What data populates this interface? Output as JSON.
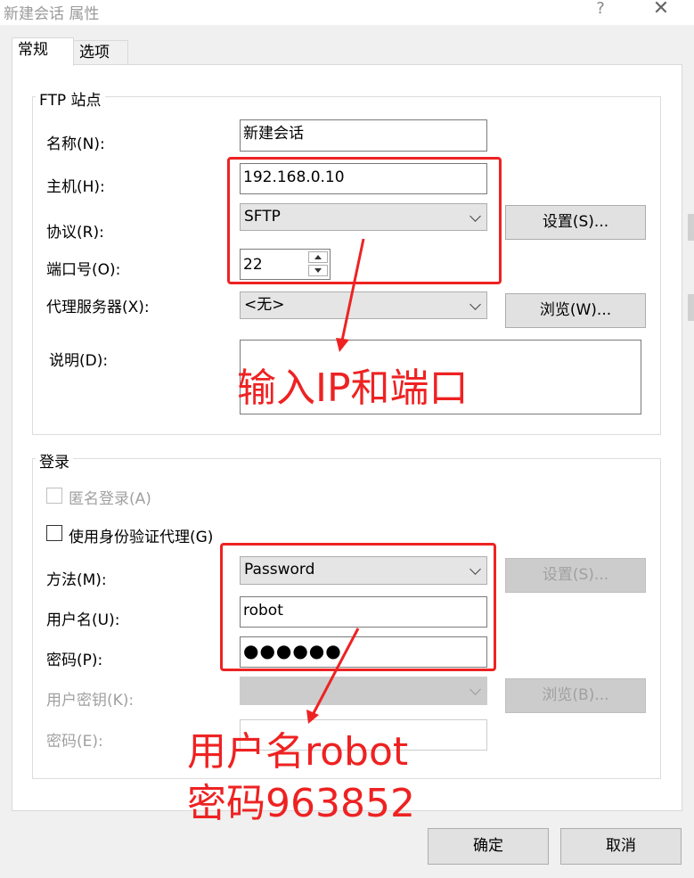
{
  "window": {
    "title": "新建会话 属性",
    "help_glyph": "?",
    "close_glyph": "✕"
  },
  "tabs": [
    {
      "label": "常规"
    },
    {
      "label": "选项"
    }
  ],
  "ftp_site": {
    "title": "FTP 站点",
    "name_label": "名称(N):",
    "name_value": "新建会话",
    "host_label": "主机(H):",
    "host_value": "192.168.0.10",
    "protocol_label": "协议(R):",
    "protocol_value": "SFTP",
    "settings_button": "设置(S)...",
    "port_label": "端口号(O):",
    "port_value": "22",
    "proxy_label": "代理服务器(X):",
    "proxy_value": "<无>",
    "browse_button": "浏览(W)...",
    "desc_label": "说明(D):"
  },
  "login": {
    "title": "登录",
    "anonymous_label": "匿名登录(A)",
    "auth_agent_label": "使用身份验证代理(G)",
    "method_label": "方法(M):",
    "method_value": "Password",
    "method_settings_button": "设置(S)...",
    "username_label": "用户名(U):",
    "username_value": "robot",
    "password_label": "密码(P):",
    "password_value": "●●●●●●",
    "userkey_label": "用户密钥(K):",
    "userkey_browse_button": "浏览(B)...",
    "passphrase_label": "密码(E):"
  },
  "footer": {
    "ok_button": "确定",
    "cancel_button": "取消"
  },
  "annotations": {
    "ip_port": "输入IP和端口",
    "username": "用户名robot",
    "password": "密码963852",
    "color": "#ee2222"
  }
}
